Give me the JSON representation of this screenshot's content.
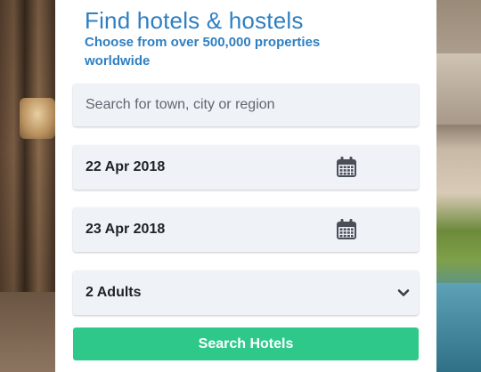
{
  "heading": {
    "title": "Find hotels & hostels",
    "subtitle": "Choose from over 500,000 properties worldwide"
  },
  "search": {
    "placeholder": "Search for town, city or region",
    "value": ""
  },
  "check_in": {
    "date": "22 Apr 2018",
    "icon": "calendar-icon"
  },
  "check_out": {
    "date": "23 Apr 2018",
    "icon": "calendar-icon"
  },
  "guests": {
    "selected": "2 Adults",
    "icon": "chevron-down-icon"
  },
  "submit": {
    "label": "Search Hotels"
  },
  "colors": {
    "heading": "#2f7fc1",
    "button": "#2ec98a",
    "field_background": "#eff2f7"
  }
}
